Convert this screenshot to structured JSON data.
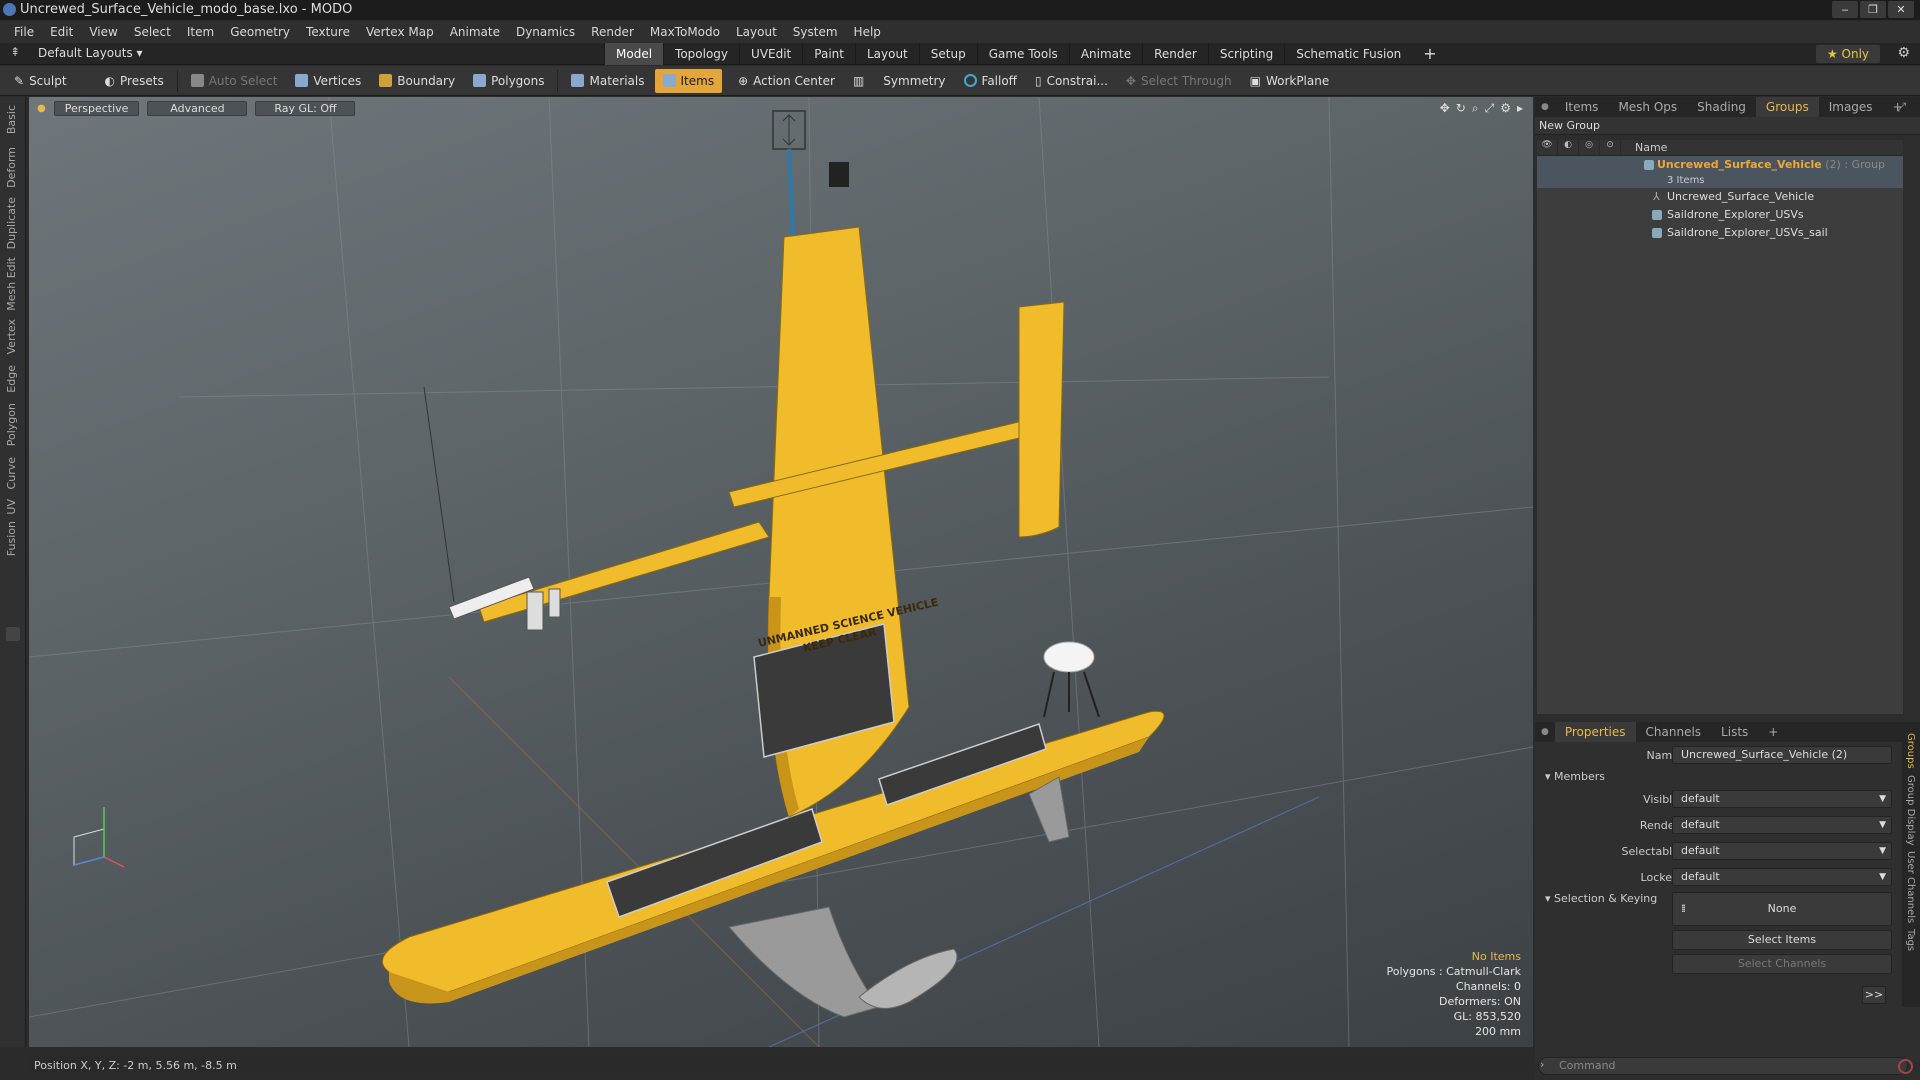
{
  "window": {
    "title": "Uncrewed_Surface_Vehicle_modo_base.lxo - MODO",
    "buttons": [
      "‒",
      "❐",
      "✕"
    ]
  },
  "menu": [
    "File",
    "Edit",
    "View",
    "Select",
    "Item",
    "Geometry",
    "Texture",
    "Vertex Map",
    "Animate",
    "Dynamics",
    "Render",
    "MaxToModo",
    "Layout",
    "System",
    "Help"
  ],
  "layout_bar": {
    "layouts_label": "Default Layouts ▾",
    "tabs": [
      {
        "label": "Model",
        "active": true
      },
      {
        "label": "Topology"
      },
      {
        "label": "UVEdit"
      },
      {
        "label": "Paint"
      },
      {
        "label": "Layout"
      },
      {
        "label": "Setup"
      },
      {
        "label": "Game Tools"
      },
      {
        "label": "Animate"
      },
      {
        "label": "Render"
      },
      {
        "label": "Scripting"
      },
      {
        "label": "Schematic Fusion"
      }
    ],
    "add_tab": "+",
    "only_label": "★  Only"
  },
  "toolbar": {
    "sculpt": "Sculpt",
    "presets": "Presets",
    "auto_select": "Auto Select",
    "vertices": "Vertices",
    "boundary": "Boundary",
    "polygons": "Polygons",
    "materials": "Materials",
    "items": "Items",
    "action_center": "Action Center",
    "symmetry": "Symmetry",
    "falloff": "Falloff",
    "constraints": "Constrai...",
    "select_through": "Select Through",
    "workplane": "WorkPlane"
  },
  "left_strip": [
    "Basic",
    "Deform",
    "Duplicate",
    "Mesh Edit",
    "Vertex",
    "Edge",
    "Polygon",
    "Curve",
    "UV",
    "Fusion"
  ],
  "viewport": {
    "perspective": "Perspective",
    "advanced": "Advanced",
    "raygl": "Ray GL: Off",
    "decal_line1": "UNMANNED SCIENCE VEHICLE",
    "decal_line2": "KEEP CLEAR",
    "info": {
      "no_items": "No Items",
      "polygons": "Polygons : Catmull-Clark",
      "channels": "Channels: 0",
      "deformers": "Deformers: ON",
      "gl": "GL: 853,520",
      "scale": "200 mm"
    },
    "colors": {
      "hull": "#f0bc2c",
      "hull_dark": "#c8941a",
      "keel": "#9a9a9a"
    }
  },
  "status": {
    "position": "Position X, Y, Z:  -2 m, 5.56 m, -8.5 m"
  },
  "top_panel": {
    "tabs": [
      {
        "label": "Items"
      },
      {
        "label": "Mesh Ops"
      },
      {
        "label": "Shading"
      },
      {
        "label": "Groups",
        "active": true
      },
      {
        "label": "Images"
      }
    ],
    "add": "+",
    "new_group": "New Group",
    "column_name": "Name",
    "group": {
      "name": "Uncrewed_Surface_Vehicle",
      "suffix": "(2) : Group",
      "count": "3 Items"
    },
    "items": [
      "Uncrewed_Surface_Vehicle",
      "Saildrone_Explorer_USVs",
      "Saildrone_Explorer_USVs_sail"
    ]
  },
  "properties": {
    "tabs": [
      {
        "label": "Properties",
        "active": true
      },
      {
        "label": "Channels"
      },
      {
        "label": "Lists"
      }
    ],
    "add": "+",
    "name_label": "Name",
    "name_value": "Uncrewed_Surface_Vehicle (2)",
    "members": "Members",
    "rows": [
      {
        "label": "Visible",
        "value": "default"
      },
      {
        "label": "Render",
        "value": "default"
      },
      {
        "label": "Selectable",
        "value": "default"
      },
      {
        "label": "Locked",
        "value": "default"
      }
    ],
    "selection_keying": "Selection & Keying",
    "none": "None",
    "select_items": "Select Items",
    "select_channels": "Select Channels",
    "more": ">>",
    "side_tabs": [
      "Groups",
      "Group Display",
      "User Channels",
      "Tags"
    ]
  },
  "command": {
    "placeholder": "Command"
  }
}
